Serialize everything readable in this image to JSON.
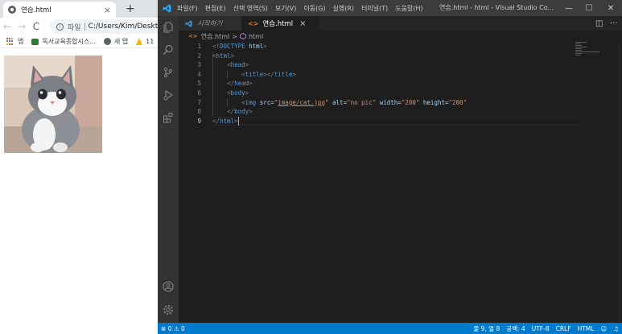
{
  "chrome": {
    "tab_title": "연습.html",
    "tab_close": "×",
    "new_tab": "+",
    "back": "←",
    "forward": "→",
    "reload": "C",
    "scheme_label": "파일",
    "url": "C:/Users/Kim/Desktop/",
    "bookmarks": [
      "앱",
      "독서교육종합시스...",
      "새 탭",
      "11"
    ],
    "image_alt": "no pic"
  },
  "vscode": {
    "menu": [
      "파일(F)",
      "편집(E)",
      "선택 영역(S)",
      "보기(V)",
      "이동(G)",
      "실행(R)",
      "터미널(T)",
      "도움말(H)"
    ],
    "window_title": "연습.html - html - Visual Studio Co...",
    "window_controls": {
      "minimize": "—",
      "maximize": "☐",
      "close": "✕"
    },
    "tabs": [
      {
        "label": "시작하기",
        "active": false
      },
      {
        "label": "연습.html",
        "active": true,
        "close": "×"
      }
    ],
    "breadcrumb": {
      "file": "연습.html",
      "separator": ">",
      "element": "html"
    },
    "line_numbers": [
      "1",
      "2",
      "3",
      "4",
      "5",
      "6",
      "7",
      "8",
      "9"
    ],
    "code_lines": [
      [
        {
          "c": "t-punct",
          "t": "<"
        },
        {
          "c": "t-doctype",
          "t": "!DOCTYPE"
        },
        {
          "c": "t-text",
          "t": " "
        },
        {
          "c": "t-attr",
          "t": "html"
        },
        {
          "c": "t-punct",
          "t": ">"
        }
      ],
      [
        {
          "c": "t-punct",
          "t": "<"
        },
        {
          "c": "t-tag",
          "t": "html"
        },
        {
          "c": "t-punct",
          "t": ">"
        }
      ],
      [
        {
          "c": "t-text",
          "t": "    "
        },
        {
          "c": "t-punct",
          "t": "<"
        },
        {
          "c": "t-tag",
          "t": "head"
        },
        {
          "c": "t-punct",
          "t": ">"
        }
      ],
      [
        {
          "c": "t-text",
          "t": "        "
        },
        {
          "c": "t-punct",
          "t": "<"
        },
        {
          "c": "t-tag",
          "t": "title"
        },
        {
          "c": "t-punct",
          "t": "></"
        },
        {
          "c": "t-tag",
          "t": "title"
        },
        {
          "c": "t-punct",
          "t": ">"
        }
      ],
      [
        {
          "c": "t-text",
          "t": "    "
        },
        {
          "c": "t-punct",
          "t": "</"
        },
        {
          "c": "t-tag",
          "t": "head"
        },
        {
          "c": "t-punct",
          "t": ">"
        }
      ],
      [
        {
          "c": "t-text",
          "t": "    "
        },
        {
          "c": "t-punct",
          "t": "<"
        },
        {
          "c": "t-tag",
          "t": "body"
        },
        {
          "c": "t-punct",
          "t": ">"
        }
      ],
      [
        {
          "c": "t-text",
          "t": "        "
        },
        {
          "c": "t-punct",
          "t": "<"
        },
        {
          "c": "t-tag",
          "t": "img"
        },
        {
          "c": "t-text",
          "t": " "
        },
        {
          "c": "t-attr",
          "t": "src"
        },
        {
          "c": "t-text",
          "t": "="
        },
        {
          "c": "t-str",
          "t": "\""
        },
        {
          "c": "t-str t-link",
          "t": "image/cat.jpg"
        },
        {
          "c": "t-str",
          "t": "\""
        },
        {
          "c": "t-text",
          "t": " "
        },
        {
          "c": "t-attr",
          "t": "alt"
        },
        {
          "c": "t-text",
          "t": "="
        },
        {
          "c": "t-str",
          "t": "\"no pic\""
        },
        {
          "c": "t-text",
          "t": " "
        },
        {
          "c": "t-attr",
          "t": "width"
        },
        {
          "c": "t-text",
          "t": "="
        },
        {
          "c": "t-str",
          "t": "\"200\""
        },
        {
          "c": "t-text",
          "t": " "
        },
        {
          "c": "t-attr",
          "t": "height"
        },
        {
          "c": "t-text",
          "t": "="
        },
        {
          "c": "t-str",
          "t": "\"200\""
        }
      ],
      [
        {
          "c": "t-text",
          "t": "    "
        },
        {
          "c": "t-punct",
          "t": "</"
        },
        {
          "c": "t-tag",
          "t": "body"
        },
        {
          "c": "t-punct",
          "t": ">"
        }
      ],
      [
        {
          "c": "t-punct",
          "t": "</"
        },
        {
          "c": "t-tag",
          "t": "html"
        },
        {
          "c": "t-punct",
          "t": ">"
        }
      ]
    ],
    "status": {
      "errors": "0",
      "warnings": "0",
      "position": "줄 9, 열 8",
      "spaces": "공백: 4",
      "encoding": "UTF-8",
      "eol": "CRLF",
      "language": "HTML"
    }
  }
}
